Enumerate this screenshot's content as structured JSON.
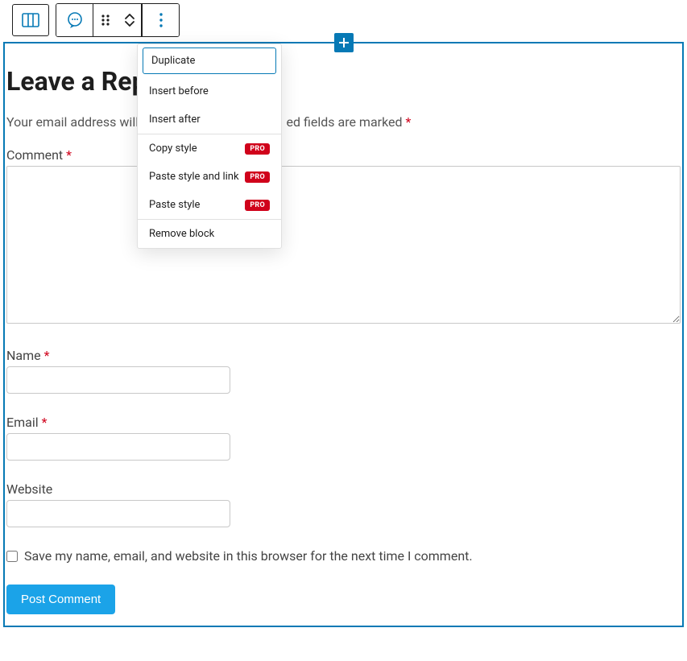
{
  "form": {
    "title": "Leave a Reply",
    "help_text_before": "Your email address will",
    "help_text_after": "ed fields are marked ",
    "labels": {
      "comment": "Comment ",
      "name": "Name ",
      "email": "Email ",
      "website": "Website"
    },
    "checkbox_label": "Save my name, email, and website in this browser for the next time I comment.",
    "submit": "Post Comment",
    "required_mark": "*"
  },
  "menu": {
    "duplicate": "Duplicate",
    "insert_before": "Insert before",
    "insert_after": "Insert after",
    "copy_style": "Copy style",
    "paste_style_link": "Paste style and link",
    "paste_style": "Paste style",
    "remove": "Remove block",
    "pro": "PRO"
  }
}
